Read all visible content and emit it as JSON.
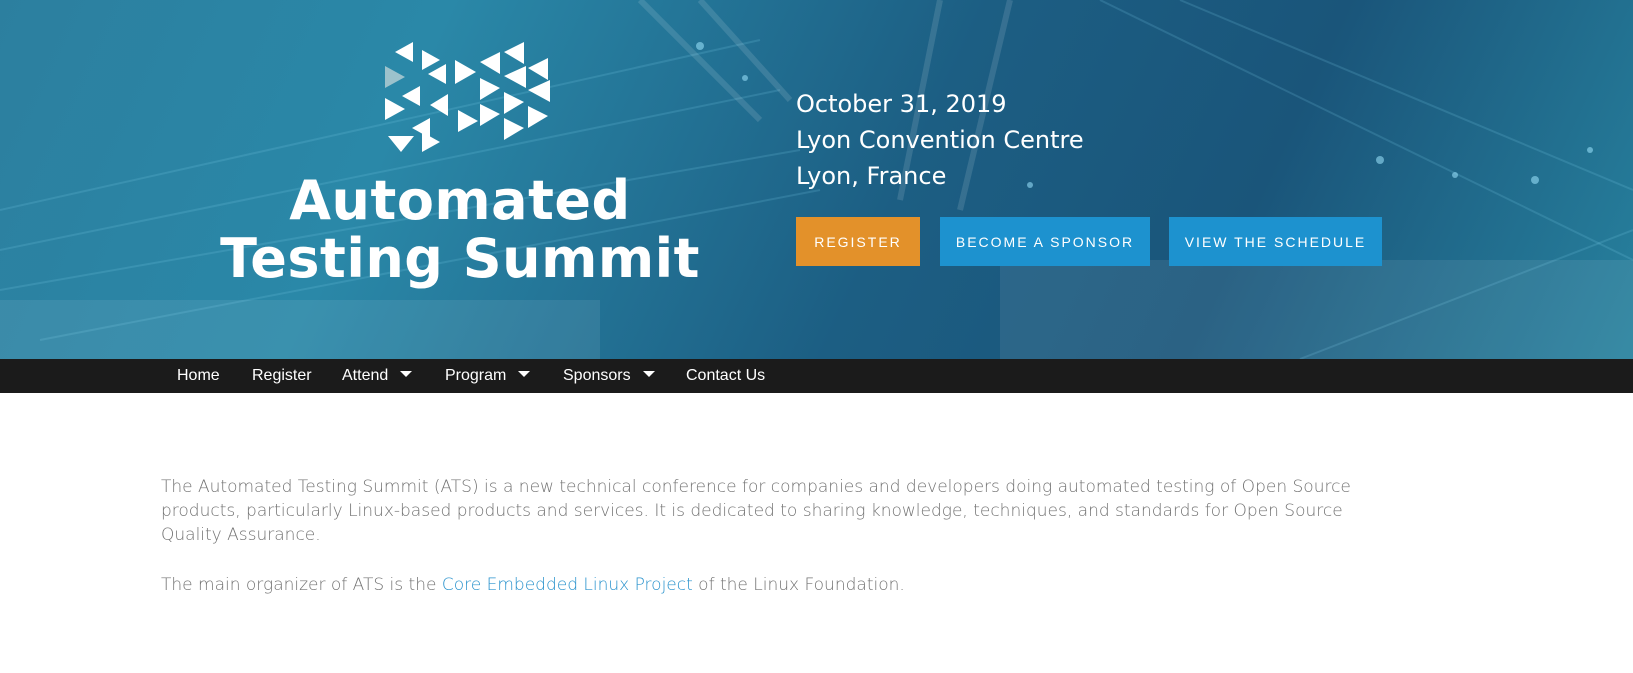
{
  "hero": {
    "title_line1": "Automated",
    "title_line2": "Testing Summit",
    "date": "October 31, 2019",
    "venue": "Lyon Convention Centre",
    "city": "Lyon, France",
    "buttons": {
      "register": "REGISTER",
      "sponsor": "BECOME A SPONSOR",
      "schedule": "VIEW THE SCHEDULE"
    }
  },
  "nav": {
    "items": [
      {
        "label": "Home",
        "dropdown": false
      },
      {
        "label": "Register",
        "dropdown": false
      },
      {
        "label": "Attend",
        "dropdown": true
      },
      {
        "label": "Program",
        "dropdown": true
      },
      {
        "label": "Sponsors",
        "dropdown": true
      },
      {
        "label": "Contact Us",
        "dropdown": false
      }
    ]
  },
  "content": {
    "intro": "The Automated Testing Summit (ATS) is a new technical conference for companies and developers doing automated testing of Open Source products, particularly Linux-based products and services. It is dedicated to sharing knowledge, techniques, and standards for Open Source Quality Assurance.",
    "organizer_prefix": "The main organizer of ATS is the ",
    "organizer_link": "Core Embedded Linux Project",
    "organizer_suffix": " of the Linux Foundation."
  },
  "colors": {
    "register_button": "#e3912a",
    "secondary_buttons": "#1d92cf",
    "navbar": "#1b1b1b",
    "link": "#2a93cd",
    "body_text": "#737373"
  },
  "icons": [
    "triangle-logo-icon",
    "caret-down-icon"
  ]
}
